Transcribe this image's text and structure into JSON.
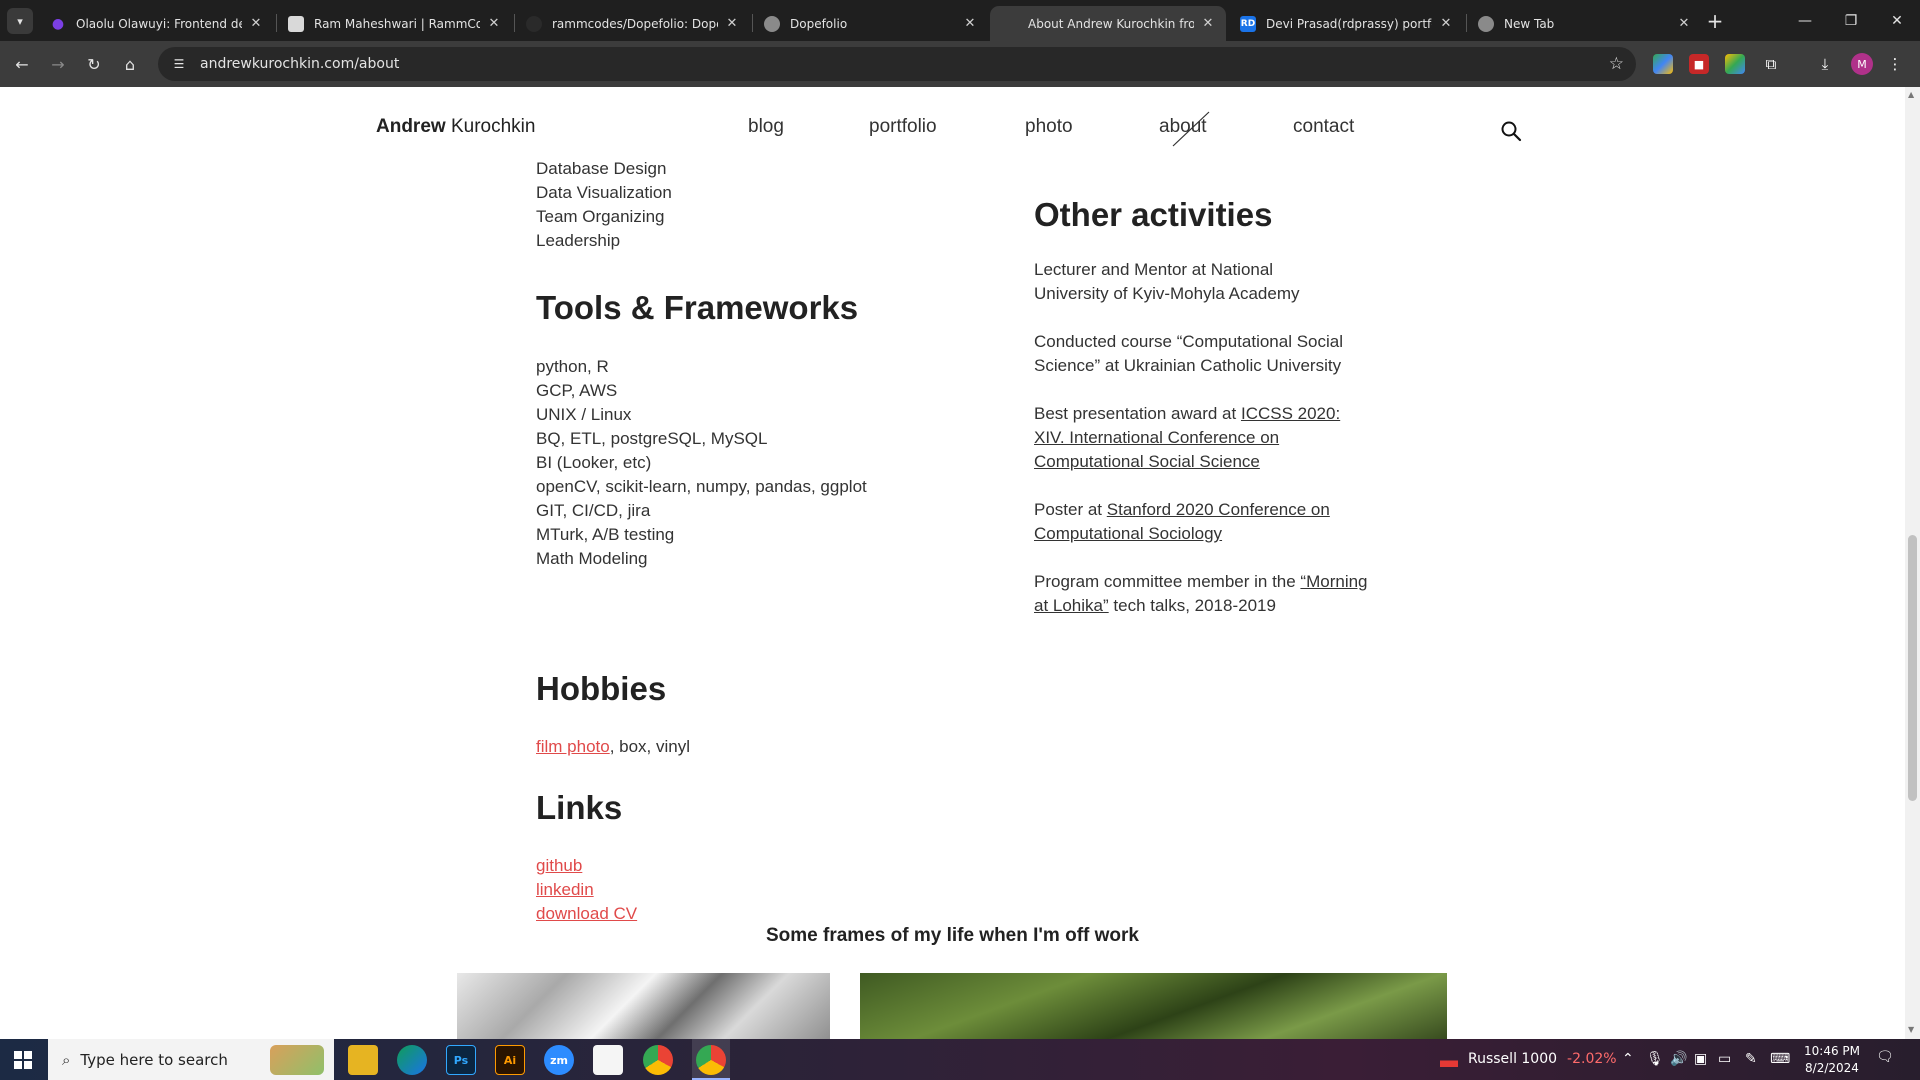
{
  "browser": {
    "tabs": [
      {
        "title": "Olaolu Olawuyi: Frontend deve",
        "favicon_color": "#7b3fe4",
        "active": false
      },
      {
        "title": "Ram Maheshwari | RammCodes",
        "favicon_color": "#d9d9d9",
        "active": false
      },
      {
        "title": "rammcodes/Dopefolio: Dopefo",
        "favicon_color": "#2a2a2a",
        "active": false
      },
      {
        "title": "Dopefolio",
        "favicon_color": "#8a8a8a",
        "active": false
      },
      {
        "title": "About Andrew Kurochkin from",
        "favicon_color": "#3c3c3c",
        "active": true
      },
      {
        "title": "Devi Prasad(rdprassy) portfolio",
        "favicon_color": "#1a73e8",
        "active": false
      },
      {
        "title": "New Tab",
        "favicon_color": "#8a8a8a",
        "active": false
      }
    ],
    "url": "andrewkurochkin.com/about",
    "profile_initial": "M"
  },
  "site": {
    "brand_first": "Andrew",
    "brand_last": "Kurochkin",
    "nav": [
      "blog",
      "portfolio",
      "photo",
      "about",
      "contact"
    ],
    "accent_color": "#e04a4a"
  },
  "content": {
    "skills_tail": [
      "Database Design",
      "Data Visualization",
      "Team Organizing",
      "Leadership"
    ],
    "tools_heading": "Tools & Frameworks",
    "tools": [
      "python, R",
      "GCP, AWS",
      "UNIX / Linux",
      "BQ, ETL, postgreSQL, MySQL",
      "BI (Looker, etc)",
      "openCV, scikit-learn, numpy, pandas, ggplot",
      "GIT, CI/CD, jira",
      "MTurk, A/B testing",
      "Math Modeling"
    ],
    "hobbies_heading": "Hobbies",
    "hobbies_link": "film photo",
    "hobbies_rest": ", box, vinyl",
    "links_heading": "Links",
    "links": [
      "github",
      "linkedin",
      "download CV"
    ],
    "other_heading": "Other activities",
    "activity_1": "Lecturer and Mentor at National University of Kyiv-Mohyla Academy",
    "activity_2": "Conducted course “Computational Social Science” at Ukrainian Catholic University",
    "activity_3_prefix": "Best presentation award at ",
    "activity_3_link": "ICCSS 2020: XIV. International Conference on Computational Social Science",
    "activity_4_prefix": "Poster at ",
    "activity_4_link": "Stanford 2020 Conference on Computational Sociology ",
    "activity_5_prefix": "Program committee member in the ",
    "activity_5_link": " “Morning at Lohika”",
    "activity_5_suffix": " tech talks, 2018-2019",
    "frames_title": "Some frames of my life when I'm off work"
  },
  "taskbar": {
    "search_placeholder": "Type here to search",
    "stock_name": "Russell 1000",
    "stock_change": "-2.02%",
    "time": "10:46 PM",
    "date": "8/2/2024"
  }
}
